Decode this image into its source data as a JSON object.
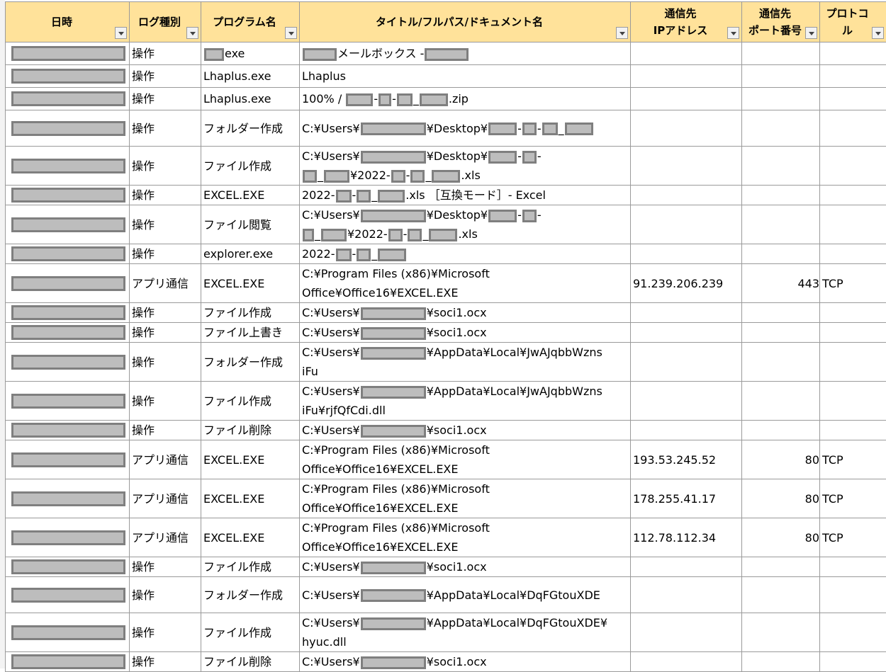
{
  "headers": {
    "datetime": "日時",
    "log_type": "ログ種別",
    "program": "プログラム名",
    "title": "タイトル/フルパス/ドキュメント名",
    "ip_l1": "通信先",
    "ip_l2": "IPアドレス",
    "port_l1": "通信先",
    "port_l2": "ポート番号",
    "proto": "プロトコル"
  },
  "rows": [
    {
      "type": "操作",
      "program": "exe",
      "title": [
        "メールボックス -"
      ],
      "ip": "",
      "port": "",
      "proto": ""
    },
    {
      "type": "操作",
      "program": "Lhaplus.exe",
      "title": [
        "Lhaplus"
      ],
      "ip": "",
      "port": "",
      "proto": ""
    },
    {
      "type": "操作",
      "program": "Lhaplus.exe",
      "title": [
        "100% /",
        ".zip"
      ],
      "ip": "",
      "port": "",
      "proto": ""
    },
    {
      "type": "操作",
      "program": "フォルダー作成",
      "title": [
        "C:¥Users¥",
        "¥Desktop¥"
      ],
      "ip": "",
      "port": "",
      "proto": ""
    },
    {
      "type": "操作",
      "program": "ファイル作成",
      "title": [
        "C:¥Users¥",
        "¥Desktop¥",
        "¥2022-",
        ".xls"
      ],
      "ip": "",
      "port": "",
      "proto": ""
    },
    {
      "type": "操作",
      "program": "EXCEL.EXE",
      "title": [
        "2022-",
        ".xls ［互換モード］- Excel"
      ],
      "ip": "",
      "port": "",
      "proto": ""
    },
    {
      "type": "操作",
      "program": "ファイル閲覧",
      "title": [
        "C:¥Users¥",
        "¥Desktop¥",
        "¥2022-",
        ".xls"
      ],
      "ip": "",
      "port": "",
      "proto": ""
    },
    {
      "type": "操作",
      "program": "explorer.exe",
      "title": [
        "2022-"
      ],
      "ip": "",
      "port": "",
      "proto": ""
    },
    {
      "type": "アプリ通信",
      "program": "EXCEL.EXE",
      "title": [
        "C:¥Program Files (x86)¥Microsoft",
        "Office¥Office16¥EXCEL.EXE"
      ],
      "ip": "91.239.206.239",
      "port": "443",
      "proto": "TCP"
    },
    {
      "type": "操作",
      "program": "ファイル作成",
      "title": [
        "C:¥Users¥",
        "¥soci1.ocx"
      ],
      "ip": "",
      "port": "",
      "proto": ""
    },
    {
      "type": "操作",
      "program": "ファイル上書き",
      "title": [
        "C:¥Users¥",
        "¥soci1.ocx"
      ],
      "ip": "",
      "port": "",
      "proto": ""
    },
    {
      "type": "操作",
      "program": "フォルダー作成",
      "title": [
        "C:¥Users¥",
        "¥AppData¥Local¥JwAJqbbWzns",
        "iFu"
      ],
      "ip": "",
      "port": "",
      "proto": ""
    },
    {
      "type": "操作",
      "program": "ファイル作成",
      "title": [
        "C:¥Users¥",
        "¥AppData¥Local¥JwAJqbbWzns",
        "iFu¥rjfQfCdi.dll"
      ],
      "ip": "",
      "port": "",
      "proto": ""
    },
    {
      "type": "操作",
      "program": "ファイル削除",
      "title": [
        "C:¥Users¥",
        "¥soci1.ocx"
      ],
      "ip": "",
      "port": "",
      "proto": ""
    },
    {
      "type": "アプリ通信",
      "program": "EXCEL.EXE",
      "title": [
        "C:¥Program Files (x86)¥Microsoft",
        "Office¥Office16¥EXCEL.EXE"
      ],
      "ip": "193.53.245.52",
      "port": "80",
      "proto": "TCP"
    },
    {
      "type": "アプリ通信",
      "program": "EXCEL.EXE",
      "title": [
        "C:¥Program Files (x86)¥Microsoft",
        "Office¥Office16¥EXCEL.EXE"
      ],
      "ip": "178.255.41.17",
      "port": "80",
      "proto": "TCP"
    },
    {
      "type": "アプリ通信",
      "program": "EXCEL.EXE",
      "title": [
        "C:¥Program Files (x86)¥Microsoft",
        "Office¥Office16¥EXCEL.EXE"
      ],
      "ip": "112.78.112.34",
      "port": "80",
      "proto": "TCP"
    },
    {
      "type": "操作",
      "program": "ファイル作成",
      "title": [
        "C:¥Users¥",
        "¥soci1.ocx"
      ],
      "ip": "",
      "port": "",
      "proto": ""
    },
    {
      "type": "操作",
      "program": "フォルダー作成",
      "title": [
        "C:¥Users¥",
        "¥AppData¥Local¥DqFGtouXDE"
      ],
      "ip": "",
      "port": "",
      "proto": ""
    },
    {
      "type": "操作",
      "program": "ファイル作成",
      "title": [
        "C:¥Users¥",
        "¥AppData¥Local¥DqFGtouXDE¥",
        "hyuc.dll"
      ],
      "ip": "",
      "port": "",
      "proto": ""
    },
    {
      "type": "操作",
      "program": "ファイル削除",
      "title": [
        "C:¥Users¥",
        "¥soci1.ocx"
      ],
      "ip": "",
      "port": "",
      "proto": ""
    }
  ]
}
